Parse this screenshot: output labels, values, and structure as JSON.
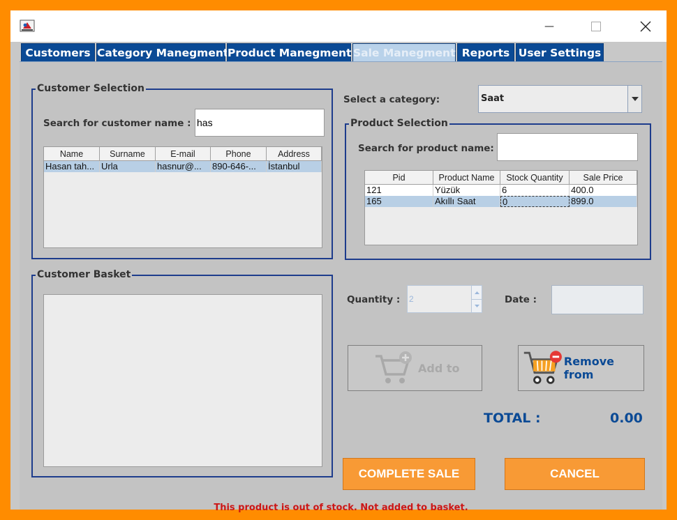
{
  "window": {
    "close": "✕",
    "maximize": "☐",
    "minimize": "—"
  },
  "tabs": [
    {
      "label": "Customers"
    },
    {
      "label": "Category Manegment"
    },
    {
      "label": "Product Manegment"
    },
    {
      "label": "Sale Manegment",
      "active": true
    },
    {
      "label": "Reports"
    },
    {
      "label": "User Settings"
    }
  ],
  "customer_selection": {
    "title": "Customer Selection",
    "search_label": "Search for customer name :",
    "search_value": "has",
    "columns": [
      "Name",
      "Surname",
      "E-mail",
      "Phone",
      "Address"
    ],
    "rows": [
      [
        "Hasan tah...",
        "Urla",
        "hasnur@...",
        "890-646-...",
        "İstanbul"
      ]
    ]
  },
  "customer_basket": {
    "title": "Customer Basket"
  },
  "category": {
    "label": "Select a category:",
    "selected": "Saat"
  },
  "product_selection": {
    "title": "Product Selection",
    "search_label": "Search for product  name:",
    "search_value": "",
    "columns": [
      "Pid",
      "Product Name",
      "Stock Quantity",
      "Sale Price"
    ],
    "rows": [
      [
        "121",
        "Yüzük",
        "6",
        "400.0"
      ],
      [
        "165",
        "Akıllı Saat",
        "0",
        "899.0"
      ]
    ]
  },
  "quantity": {
    "label": "Quantity :",
    "value": "2"
  },
  "date": {
    "label": "Date :",
    "value": ""
  },
  "buttons": {
    "add": "Add to",
    "remove": "Remove from",
    "complete": "COMPLETE SALE",
    "cancel": "CANCEL"
  },
  "total": {
    "label": "TOTAL :",
    "value": "0.00"
  },
  "status_message": "This product is out of stock. Not added to basket.",
  "colors": {
    "frame": "#ff8c00",
    "tab_active": "#b9d2ea",
    "tab": "#0b4a95",
    "accent_button": "#f89a35",
    "error_text": "#cc1616"
  }
}
